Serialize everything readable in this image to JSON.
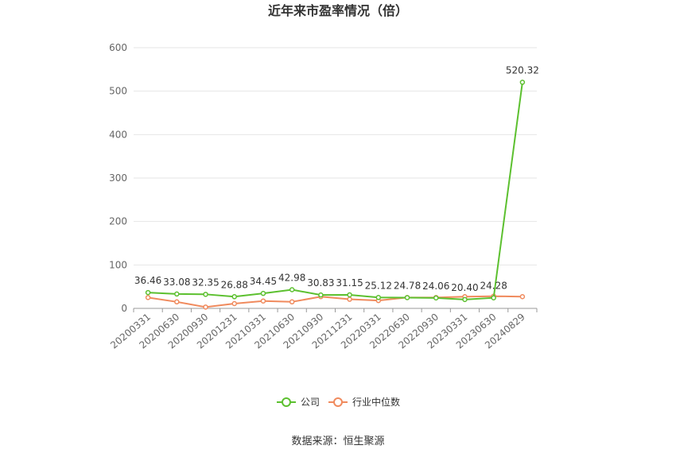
{
  "chart_data": {
    "type": "line",
    "title": "近年来市盈率情况（倍）",
    "categories": [
      "20200331",
      "20200630",
      "20200930",
      "20201231",
      "20210331",
      "20210630",
      "20210930",
      "20211231",
      "20220331",
      "20220630",
      "20220930",
      "20230331",
      "20230630",
      "20240829"
    ],
    "series": [
      {
        "name": "公司",
        "color": "#5cc02f",
        "values": [
          36.46,
          33.08,
          32.35,
          26.88,
          34.45,
          42.98,
          30.83,
          31.15,
          25.12,
          24.78,
          24.06,
          20.4,
          24.28,
          520.32
        ],
        "labels": [
          "36.46",
          "33.08",
          "32.35",
          "26.88",
          "34.45",
          "42.98",
          "30.83",
          "31.15",
          "25.12",
          "24.78",
          "24.06",
          "20.40",
          "24.28",
          "520.32"
        ]
      },
      {
        "name": "行业中位数",
        "color": "#f08a5d",
        "values": [
          25,
          15,
          3,
          11,
          17,
          15,
          27,
          21,
          18,
          25,
          25,
          27,
          28,
          27
        ]
      }
    ],
    "yticks": [
      "0",
      "100",
      "200",
      "300",
      "400",
      "500",
      "600"
    ],
    "ylim": [
      0,
      600
    ],
    "grid": true,
    "legend_position": "bottom"
  },
  "source": "数据来源：恒生聚源"
}
